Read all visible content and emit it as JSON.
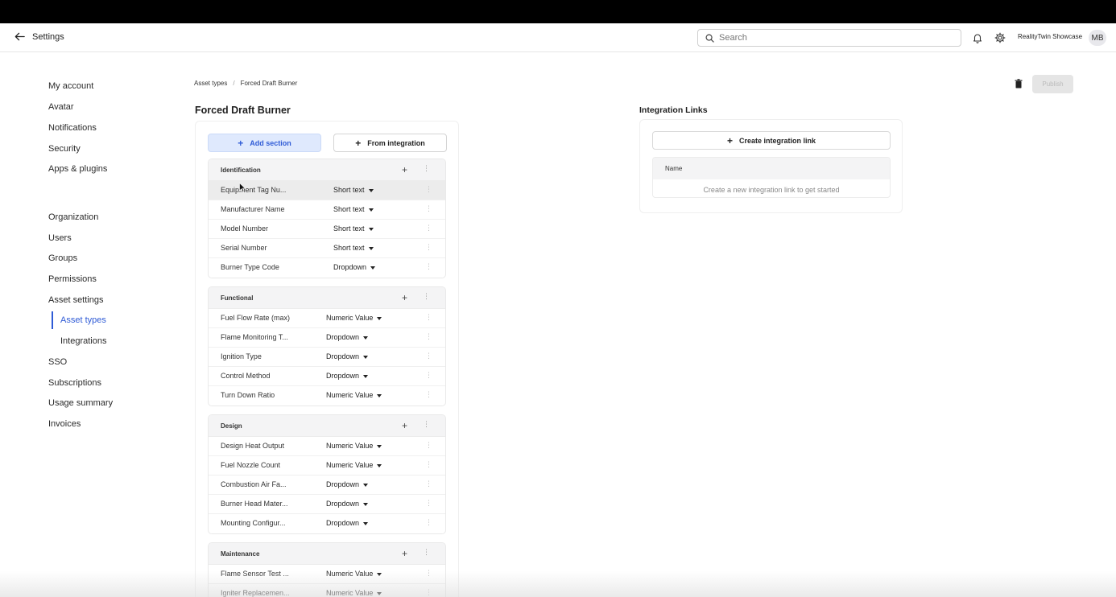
{
  "header": {
    "back_label": "Settings",
    "search_placeholder": "Search",
    "org_name": "RealityTwin Showcase",
    "avatar_initials": "MB"
  },
  "nav": {
    "items": [
      {
        "label": "My account"
      },
      {
        "label": "Avatar"
      },
      {
        "label": "Notifications"
      },
      {
        "label": "Security"
      },
      {
        "label": "Apps & plugins"
      },
      {
        "label": "Organization"
      },
      {
        "label": "Users"
      },
      {
        "label": "Groups"
      },
      {
        "label": "Permissions"
      },
      {
        "label": "Asset settings"
      },
      {
        "label": "Asset types"
      },
      {
        "label": "Integrations"
      },
      {
        "label": "SSO"
      },
      {
        "label": "Subscriptions"
      },
      {
        "label": "Usage summary"
      },
      {
        "label": "Invoices"
      }
    ]
  },
  "breadcrumb": {
    "parent": "Asset types",
    "separator": "/",
    "current": "Forced Draft Burner"
  },
  "actions": {
    "publish_label": "Publish"
  },
  "page": {
    "title": "Forced Draft Burner",
    "add_section_label": "Add section",
    "from_integration_label": "From integration"
  },
  "sections": [
    {
      "title": "Identification",
      "fields": [
        {
          "name": "Equipment Tag Nu...",
          "type": "Short text"
        },
        {
          "name": "Manufacturer Name",
          "type": "Short text"
        },
        {
          "name": "Model Number",
          "type": "Short text"
        },
        {
          "name": "Serial Number",
          "type": "Short text"
        },
        {
          "name": "Burner Type Code",
          "type": "Dropdown"
        }
      ]
    },
    {
      "title": "Functional",
      "fields": [
        {
          "name": "Fuel Flow Rate (max)",
          "type": "Numeric Value"
        },
        {
          "name": "Flame Monitoring T...",
          "type": "Dropdown"
        },
        {
          "name": "Ignition Type",
          "type": "Dropdown"
        },
        {
          "name": "Control Method",
          "type": "Dropdown"
        },
        {
          "name": "Turn Down Ratio",
          "type": "Numeric Value"
        }
      ]
    },
    {
      "title": "Design",
      "fields": [
        {
          "name": "Design Heat Output",
          "type": "Numeric Value"
        },
        {
          "name": "Fuel Nozzle Count",
          "type": "Numeric Value"
        },
        {
          "name": "Combustion Air Fa...",
          "type": "Dropdown"
        },
        {
          "name": "Burner Head Mater...",
          "type": "Dropdown"
        },
        {
          "name": "Mounting Configur...",
          "type": "Dropdown"
        }
      ]
    },
    {
      "title": "Maintenance",
      "fields": [
        {
          "name": "Flame Sensor Test ...",
          "type": "Numeric Value"
        },
        {
          "name": "Igniter Replacemen...",
          "type": "Numeric Value"
        }
      ]
    }
  ],
  "integration": {
    "title": "Integration Links",
    "create_label": "Create integration link",
    "column_name": "Name",
    "empty_text": "Create a new integration link to get started"
  }
}
